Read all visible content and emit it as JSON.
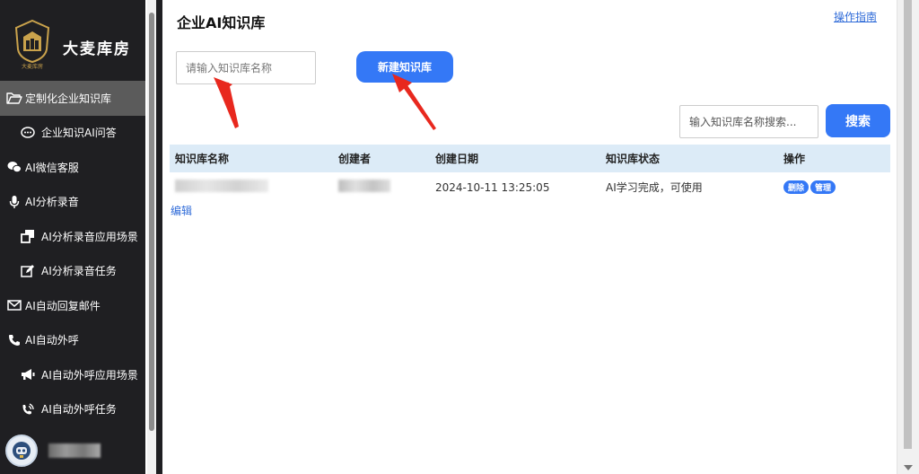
{
  "brand": {
    "name": "大麦库房",
    "emblem_text": "大麦库房"
  },
  "sidebar": {
    "items": [
      {
        "label": "定制化企业知识库",
        "icon": "folder-open-icon",
        "level": 0,
        "active": true
      },
      {
        "label": "企业知识AI问答",
        "icon": "chat-bubble-icon",
        "level": 1,
        "active": false
      },
      {
        "label": "AI微信客服",
        "icon": "wechat-icon",
        "level": 0,
        "active": false
      },
      {
        "label": "AI分析录音",
        "icon": "microphone-icon",
        "level": 0,
        "active": false
      },
      {
        "label": "AI分析录音应用场景",
        "icon": "window-restore-icon",
        "level": 1,
        "active": false
      },
      {
        "label": "AI分析录音任务",
        "icon": "edit-icon",
        "level": 1,
        "active": false
      },
      {
        "label": "AI自动回复邮件",
        "icon": "envelope-icon",
        "level": 0,
        "active": false
      },
      {
        "label": "AI自动外呼",
        "icon": "phone-icon",
        "level": 0,
        "active": false
      },
      {
        "label": "AI自动外呼应用场景",
        "icon": "megaphone-icon",
        "level": 1,
        "active": false
      },
      {
        "label": "AI自动外呼任务",
        "icon": "phone-volume-icon",
        "level": 1,
        "active": false
      }
    ]
  },
  "main": {
    "title": "企业AI知识库",
    "guide_link": "操作指南",
    "name_input_placeholder": "请输入知识库名称",
    "create_button": "新建知识库",
    "search_placeholder": "输入知识库名称搜索...",
    "search_button": "搜索",
    "table": {
      "headers": [
        "知识库名称",
        "创建者",
        "创建日期",
        "知识库状态",
        "操作"
      ],
      "rows": [
        {
          "created": "2024-10-11 13:25:05",
          "status": "AI学习完成，可使用",
          "actions": [
            "删除",
            "管理"
          ]
        }
      ]
    },
    "edit_link": "编辑"
  },
  "colors": {
    "sidebar_bg": "#1f1f22",
    "accent": "#3478f6",
    "header_bg": "#dcebf7",
    "annotation": "#e8281e"
  }
}
